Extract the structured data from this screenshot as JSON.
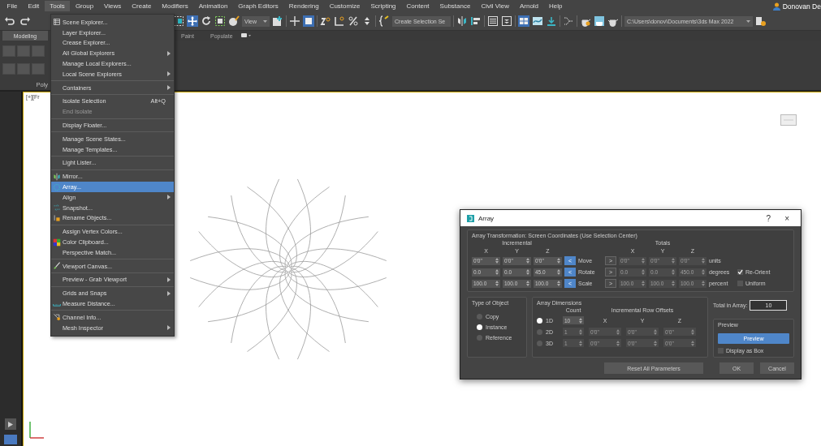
{
  "menubar": {
    "items": [
      {
        "label": "File",
        "selected": false
      },
      {
        "label": "Edit",
        "selected": false
      },
      {
        "label": "Tools",
        "selected": true
      },
      {
        "label": "Group",
        "selected": false
      },
      {
        "label": "Views",
        "selected": false
      },
      {
        "label": "Create",
        "selected": false
      },
      {
        "label": "Modifiers",
        "selected": false
      },
      {
        "label": "Animation",
        "selected": false
      },
      {
        "label": "Graph Editors",
        "selected": false
      },
      {
        "label": "Rendering",
        "selected": false
      },
      {
        "label": "Customize",
        "selected": false
      },
      {
        "label": "Scripting",
        "selected": false
      },
      {
        "label": "Content",
        "selected": false
      },
      {
        "label": "Substance",
        "selected": false
      },
      {
        "label": "Civil View",
        "selected": false
      },
      {
        "label": "Arnold",
        "selected": false
      },
      {
        "label": "Help",
        "selected": false
      }
    ],
    "user": "Donovan De"
  },
  "toolbar": {
    "view_dropdown": "View",
    "selection_set": "Create Selection Se",
    "path": "C:\\Users\\donov\\Documents\\3ds Max 2022"
  },
  "ribbon": {
    "tabs": [
      {
        "label": "Modeling",
        "selected": true
      },
      {
        "label": "Paint",
        "selected": false
      },
      {
        "label": "Populate",
        "selected": false
      }
    ],
    "panel_label": "Poly"
  },
  "viewport": {
    "label": "[+][Fr"
  },
  "tools_menu": {
    "items": [
      {
        "kind": "item",
        "label": "Scene Explorer...",
        "submenu": false,
        "disabled": false,
        "selected": false
      },
      {
        "kind": "item",
        "label": "Layer Explorer...",
        "submenu": false,
        "disabled": false,
        "selected": false
      },
      {
        "kind": "item",
        "label": "Crease Explorer...",
        "submenu": false,
        "disabled": false,
        "selected": false
      },
      {
        "kind": "item",
        "label": "All Global Explorers",
        "submenu": true,
        "disabled": false,
        "selected": false
      },
      {
        "kind": "item",
        "label": "Manage Local Explorers...",
        "submenu": false,
        "disabled": false,
        "selected": false
      },
      {
        "kind": "item",
        "label": "Local Scene Explorers",
        "submenu": true,
        "disabled": false,
        "selected": false
      },
      {
        "kind": "separator"
      },
      {
        "kind": "item",
        "label": "Containers",
        "submenu": true,
        "disabled": false,
        "selected": false
      },
      {
        "kind": "separator"
      },
      {
        "kind": "item",
        "label": "Isolate Selection",
        "shortcut": "Alt+Q",
        "submenu": false,
        "disabled": false,
        "selected": false
      },
      {
        "kind": "item",
        "label": "End Isolate",
        "submenu": false,
        "disabled": true,
        "selected": false
      },
      {
        "kind": "separator"
      },
      {
        "kind": "item",
        "label": "Display Floater...",
        "submenu": false,
        "disabled": false,
        "selected": false
      },
      {
        "kind": "separator"
      },
      {
        "kind": "item",
        "label": "Manage Scene States...",
        "submenu": false,
        "disabled": false,
        "selected": false
      },
      {
        "kind": "item",
        "label": "Manage Templates...",
        "submenu": false,
        "disabled": false,
        "selected": false
      },
      {
        "kind": "separator"
      },
      {
        "kind": "item",
        "label": "Light Lister...",
        "submenu": false,
        "disabled": false,
        "selected": false
      },
      {
        "kind": "separator"
      },
      {
        "kind": "item",
        "label": "Mirror...",
        "submenu": false,
        "disabled": false,
        "selected": false
      },
      {
        "kind": "item",
        "label": "Array...",
        "submenu": false,
        "disabled": false,
        "selected": true
      },
      {
        "kind": "item",
        "label": "Align",
        "submenu": true,
        "disabled": false,
        "selected": false
      },
      {
        "kind": "item",
        "label": "Snapshot...",
        "submenu": false,
        "disabled": false,
        "selected": false
      },
      {
        "kind": "item",
        "label": "Rename Objects...",
        "submenu": false,
        "disabled": false,
        "selected": false
      },
      {
        "kind": "separator"
      },
      {
        "kind": "item",
        "label": "Assign Vertex Colors...",
        "submenu": false,
        "disabled": false,
        "selected": false
      },
      {
        "kind": "item",
        "label": "Color Clipboard...",
        "submenu": false,
        "disabled": false,
        "selected": false
      },
      {
        "kind": "item",
        "label": "Perspective Match...",
        "submenu": false,
        "disabled": false,
        "selected": false
      },
      {
        "kind": "separator"
      },
      {
        "kind": "item",
        "label": "Viewport Canvas...",
        "submenu": false,
        "disabled": false,
        "selected": false
      },
      {
        "kind": "separator"
      },
      {
        "kind": "item",
        "label": "Preview - Grab Viewport",
        "submenu": true,
        "disabled": false,
        "selected": false
      },
      {
        "kind": "separator"
      },
      {
        "kind": "item",
        "label": "Grids and Snaps",
        "submenu": true,
        "disabled": false,
        "selected": false
      },
      {
        "kind": "item",
        "label": "Measure Distance...",
        "submenu": false,
        "disabled": false,
        "selected": false
      },
      {
        "kind": "separator"
      },
      {
        "kind": "item",
        "label": "Channel Info...",
        "submenu": false,
        "disabled": false,
        "selected": false
      },
      {
        "kind": "item",
        "label": "Mesh Inspector",
        "submenu": true,
        "disabled": false,
        "selected": false
      }
    ]
  },
  "array_dialog": {
    "title": "Array",
    "help": "?",
    "close": "×",
    "transform": {
      "title": "Array Transformation: Screen Coordinates (Use Selection Center)",
      "incremental_label": "Incremental",
      "totals_label": "Totals",
      "incremental_axes": [
        "X",
        "Y",
        "Z"
      ],
      "totals_axes": [
        "X",
        "Y",
        "Z"
      ],
      "totals_disabled": true,
      "rows": [
        {
          "incremental": [
            "0'0\"",
            "0'0\"",
            "0'0\""
          ],
          "left_button": {
            "label": "<",
            "active": true
          },
          "name": "Move",
          "right_button": {
            "label": ">",
            "active": false
          },
          "totals": [
            "0'0\"",
            "0'0\"",
            "0'0\""
          ],
          "unit": "units"
        },
        {
          "incremental": [
            "0.0",
            "0.0",
            "45.0"
          ],
          "left_button": {
            "label": "<",
            "active": true
          },
          "name": "Rotate",
          "right_button": {
            "label": ">",
            "active": false
          },
          "totals": [
            "0.0",
            "0.0",
            "450.0"
          ],
          "unit": "degrees",
          "option": {
            "label": "Re-Orient",
            "checked": true
          }
        },
        {
          "incremental": [
            "100.0",
            "100.0",
            "100.0"
          ],
          "left_button": {
            "label": "<",
            "active": true
          },
          "name": "Scale",
          "right_button": {
            "label": ">",
            "active": false
          },
          "totals": [
            "100.0",
            "100.0",
            "100.0"
          ],
          "unit": "percent",
          "option": {
            "label": "Uniform",
            "checked": false
          }
        }
      ]
    },
    "type_of_object": {
      "title": "Type of Object",
      "options": [
        {
          "label": "Copy",
          "selected": false
        },
        {
          "label": "Instance",
          "selected": true
        },
        {
          "label": "Reference",
          "selected": false
        }
      ]
    },
    "dimensions": {
      "title": "Array Dimensions",
      "count_label": "Count",
      "offsets_label": "Incremental Row Offsets",
      "axes": [
        "X",
        "Y",
        "Z"
      ],
      "rows": [
        {
          "label": "1D",
          "selected": true,
          "disabled": false,
          "count": "10"
        },
        {
          "label": "2D",
          "selected": false,
          "disabled": true,
          "count": "1",
          "offsets": [
            "0'0\"",
            "0'0\"",
            "0'0\""
          ]
        },
        {
          "label": "3D",
          "selected": false,
          "disabled": true,
          "count": "1",
          "offsets": [
            "0'0\"",
            "0'0\"",
            "0'0\""
          ]
        }
      ]
    },
    "total": {
      "label": "Total in Array:",
      "value": "10"
    },
    "preview": {
      "title": "Preview",
      "button": "Preview",
      "display_as_box": {
        "label": "Display as Box",
        "checked": false
      }
    },
    "buttons": [
      "Reset All Parameters",
      "OK",
      "Cancel"
    ]
  }
}
